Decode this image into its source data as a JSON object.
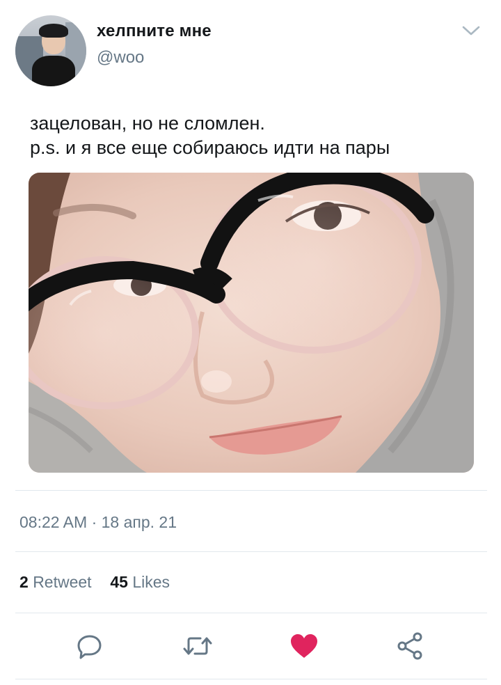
{
  "user": {
    "display_name": "хелпните мне",
    "handle": "@woo",
    "avatar_icon": "user-avatar"
  },
  "menu_icon": "chevron-down-icon",
  "tweet": {
    "lines": [
      "зацелован, но не сломлен.",
      "p.s. и я все еще собираюсь идти на пары"
    ]
  },
  "timestamp": "08:22 AM · 18 апр. 21",
  "stats": {
    "retweet_count": "2",
    "retweet_label": "Retweet",
    "like_count": "45",
    "like_label": "Likes"
  },
  "actions": {
    "reply_icon": "reply-icon",
    "retweet_icon": "retweet-icon",
    "like_icon": "heart-icon",
    "share_icon": "share-icon"
  },
  "colors": {
    "text": "#14171a",
    "secondary": "#657786",
    "divider": "#e1e8ed",
    "like": "#e0245e",
    "icon": "#657786"
  }
}
